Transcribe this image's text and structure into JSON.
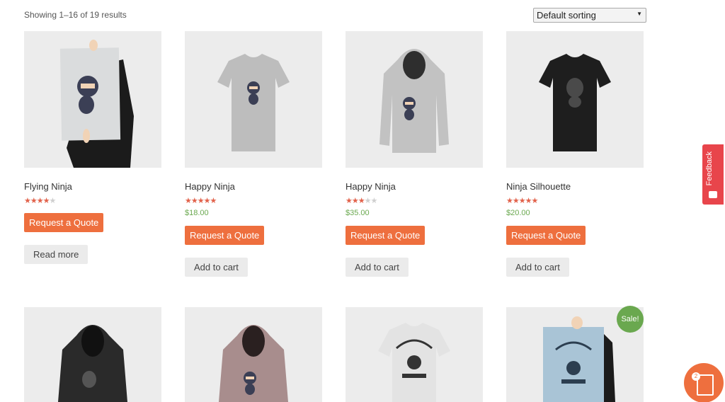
{
  "result_count": "Showing 1–16 of 19 results",
  "sorting": {
    "selected": "Default sorting"
  },
  "products": [
    {
      "title": "Flying Ninja",
      "rating": 4,
      "price": "",
      "quote_label": "Request a Quote",
      "action_label": "Read more",
      "image": "poster-ninja"
    },
    {
      "title": "Happy Ninja",
      "rating": 5,
      "price": "$18.00",
      "quote_label": "Request a Quote",
      "action_label": "Add to cart",
      "image": "tshirt-grey"
    },
    {
      "title": "Happy Ninja",
      "rating": 3,
      "price": "$35.00",
      "quote_label": "Request a Quote",
      "action_label": "Add to cart",
      "image": "hoodie-grey"
    },
    {
      "title": "Ninja Silhouette",
      "rating": 5,
      "price": "$20.00",
      "quote_label": "Request a Quote",
      "action_label": "Add to cart",
      "image": "tshirt-black"
    },
    {
      "image": "hoodie-black"
    },
    {
      "image": "hoodie-pink"
    },
    {
      "image": "tshirt-woothemes"
    },
    {
      "image": "poster-woothemes",
      "sale_label": "Sale!"
    }
  ],
  "feedback_tab": {
    "label": "Feedback"
  },
  "quote_widget": {
    "count": "2"
  },
  "colors": {
    "accent": "#ee6f3e",
    "price": "#6aa84f",
    "feedback": "#e8454b"
  }
}
